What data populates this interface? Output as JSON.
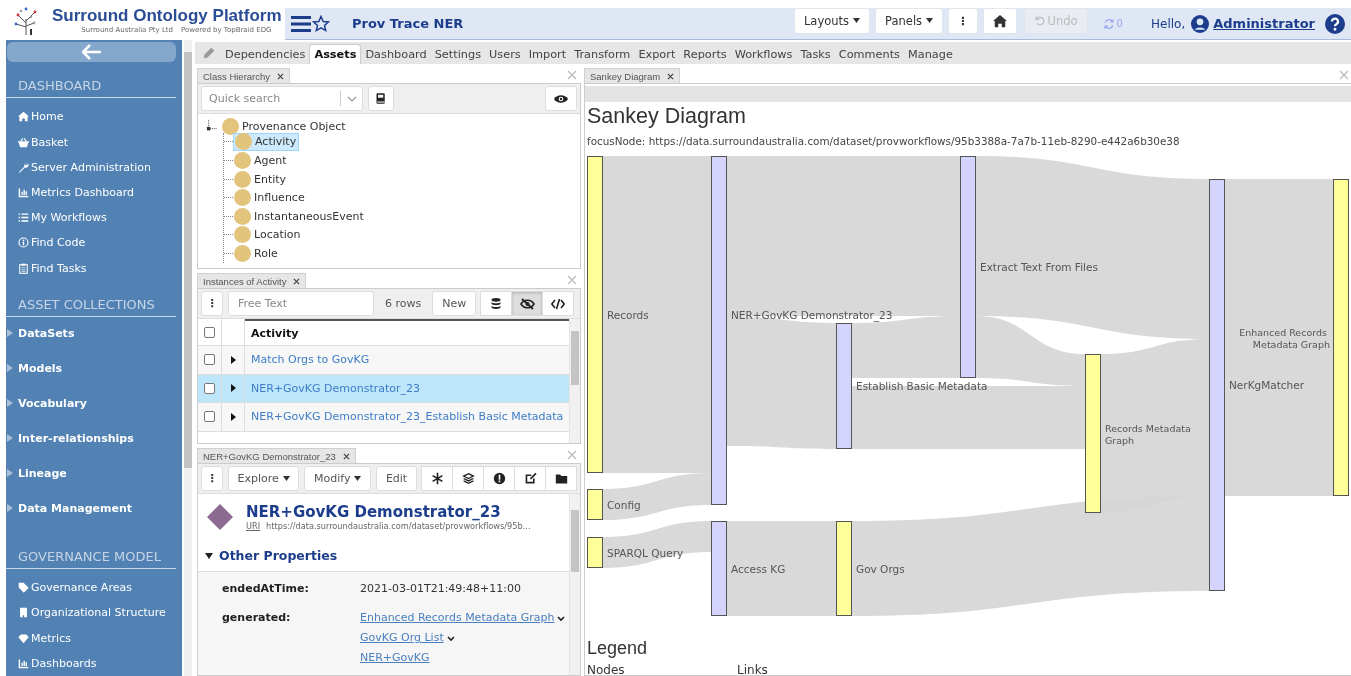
{
  "header": {
    "logo_title": "Surround Ontology Platform",
    "logo_company": "Surround Australia Pty Ltd",
    "logo_powered": "Powered by TopBraid EDG",
    "page_title": "Prov Trace NER",
    "buttons": [
      {
        "kind": "dropdown",
        "label": "Layouts"
      },
      {
        "kind": "dropdown",
        "label": "Panels"
      },
      {
        "kind": "kebab",
        "label": "⋮"
      },
      {
        "kind": "home"
      }
    ],
    "undo": {
      "label": "Undo",
      "disabled": true
    },
    "sync_count": "0",
    "greeting": "Hello,",
    "user": "Administrator"
  },
  "sidebar": {
    "sections": [
      {
        "title": "DASHBOARD",
        "kind": "links",
        "items": [
          {
            "label": "Home"
          },
          {
            "label": "Basket"
          },
          {
            "label": "Server Administration"
          },
          {
            "label": "Metrics Dashboard"
          },
          {
            "label": "My Workflows"
          },
          {
            "label": "Find Code"
          },
          {
            "label": "Find Tasks"
          }
        ]
      },
      {
        "title": "ASSET COLLECTIONS",
        "kind": "groups",
        "items": [
          {
            "label": "DataSets",
            "expanded": false
          },
          {
            "label": "Models",
            "expanded": false
          },
          {
            "label": "Vocabulary",
            "expanded": false
          },
          {
            "label": "Inter-relationships",
            "expanded": false
          },
          {
            "label": "Lineage",
            "expanded": false
          },
          {
            "label": "Data Management",
            "expanded": false
          }
        ]
      },
      {
        "title": "GOVERNANCE MODEL",
        "kind": "links",
        "items": [
          {
            "label": "Governance Areas"
          },
          {
            "label": "Organizational Structure"
          },
          {
            "label": "Metrics"
          },
          {
            "label": "Dashboards"
          }
        ]
      }
    ]
  },
  "tabs": [
    {
      "label": "Dependencies",
      "selected": false
    },
    {
      "label": "Assets",
      "selected": true
    },
    {
      "label": "Dashboard",
      "selected": false
    },
    {
      "label": "Settings",
      "selected": false
    },
    {
      "label": "Users",
      "selected": false
    },
    {
      "label": "Import",
      "selected": false
    },
    {
      "label": "Transform",
      "selected": false
    },
    {
      "label": "Export",
      "selected": false
    },
    {
      "label": "Reports",
      "selected": false
    },
    {
      "label": "Workflows",
      "selected": false
    },
    {
      "label": "Tasks",
      "selected": false
    },
    {
      "label": "Comments",
      "selected": false
    },
    {
      "label": "Manage",
      "selected": false
    }
  ],
  "class_hierarchy": {
    "tab": "Class Hierarchy",
    "search_placeholder": "Quick search",
    "tree": {
      "label": "Provenance Object",
      "selected": false,
      "children": [
        {
          "label": "Activity",
          "selected": true
        },
        {
          "label": "Agent",
          "selected": false
        },
        {
          "label": "Entity",
          "selected": false
        },
        {
          "label": "Influence",
          "selected": false
        },
        {
          "label": "InstantaneousEvent",
          "selected": false
        },
        {
          "label": "Location",
          "selected": false
        },
        {
          "label": "Role",
          "selected": false
        }
      ]
    }
  },
  "instances": {
    "tab": "Instances of Activity",
    "menu_button": "⋮",
    "search_placeholder": "Free Text",
    "row_count": "6 rows",
    "new_button": "New",
    "eye_toggle_on": true,
    "header_checked": false,
    "columns": [
      "Activity"
    ],
    "rows": [
      {
        "label": "Match Orgs to GovKG",
        "selected": false,
        "checked": false
      },
      {
        "label": "NER+GovKG Demonstrator_23",
        "selected": true,
        "checked": false
      },
      {
        "label": "NER+GovKG Demonstrator_23_Establish Basic Metadata",
        "selected": false,
        "checked": false
      }
    ]
  },
  "details": {
    "tab": "NER+GovKG Demonstrator_23",
    "buttons": [
      {
        "kind": "kebab",
        "label": "⋮"
      },
      {
        "kind": "dropdown",
        "label": "Explore"
      },
      {
        "kind": "dropdown",
        "label": "Modify"
      },
      {
        "kind": "plain",
        "label": "Edit"
      }
    ],
    "title": "NER+GovKG Demonstrator_23",
    "uri_label": "URI",
    "uri": "https://data.surroundaustralia.com/dataset/provworkflows/95b...",
    "section": {
      "label": "Other Properties",
      "expanded": true
    },
    "properties": [
      {
        "name": "endedAtTime:",
        "values": [
          {
            "kind": "literal",
            "text": "2021-03-01T21:49:48+11:00",
            "menu": false
          }
        ]
      },
      {
        "name": "generated:",
        "values": [
          {
            "kind": "link",
            "text": "Enhanced Records Metadata Graph",
            "menu": true
          },
          {
            "kind": "link",
            "text": "GovKG Org List",
            "menu": true
          },
          {
            "kind": "link",
            "text": "NER+GovKG",
            "menu": false
          }
        ]
      }
    ]
  },
  "sankey": {
    "tab": "Sankey Diagram",
    "title": "Sankey Diagram",
    "focus": "focusNode: https://data.surroundaustralia.com/dataset/provworkflows/95b3388a-7a7b-11eb-8290-e442a6b30e38",
    "nodes": [
      {
        "label": "Records",
        "kind": "entity"
      },
      {
        "label": "Config",
        "kind": "entity"
      },
      {
        "label": "SPARQL Query",
        "kind": "entity"
      },
      {
        "label": "NER+GovKG Demonstrator_23",
        "kind": "activity"
      },
      {
        "label": "Access KG",
        "kind": "activity"
      },
      {
        "label": "Establish Basic Metadata",
        "kind": "activity"
      },
      {
        "label": "Gov Orgs",
        "kind": "entity"
      },
      {
        "label": "Extract Text From Files",
        "kind": "activity"
      },
      {
        "label": "Records Metadata Graph",
        "kind": "entity"
      },
      {
        "label": "Enhanced Records Metadata Graph",
        "kind": "entity"
      },
      {
        "label": "NerKgMatcher",
        "kind": "activity"
      }
    ],
    "legend_title": "Legend",
    "legend_columns": [
      "Nodes",
      "Links"
    ]
  }
}
